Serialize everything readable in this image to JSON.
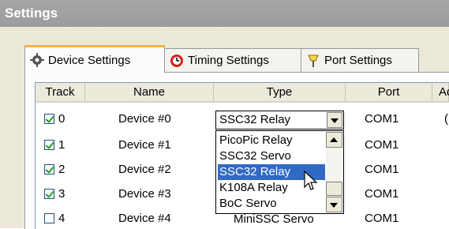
{
  "window": {
    "title": "Settings"
  },
  "tabs": [
    {
      "label": "Device Settings",
      "icon": "gear-icon",
      "active": true
    },
    {
      "label": "Timing Settings",
      "icon": "timer-icon",
      "active": false
    },
    {
      "label": "Port Settings",
      "icon": "port-icon",
      "active": false
    }
  ],
  "table": {
    "headers": [
      "Track",
      "Name",
      "Type",
      "Port",
      "Ad"
    ],
    "rows": [
      {
        "index": "0",
        "checked": true,
        "name": "Device #0",
        "type": "SSC32 Relay",
        "port": "COM1",
        "addr": "("
      },
      {
        "index": "1",
        "checked": true,
        "name": "Device #1",
        "type": "",
        "port": "COM1",
        "addr": ""
      },
      {
        "index": "2",
        "checked": true,
        "name": "Device #2",
        "type": "",
        "port": "COM1",
        "addr": ""
      },
      {
        "index": "3",
        "checked": true,
        "name": "Device #3",
        "type": "",
        "port": "COM1",
        "addr": ""
      },
      {
        "index": "4",
        "checked": false,
        "name": "Device #4",
        "type": "MiniSSC Servo",
        "port": "COM1",
        "addr": ""
      }
    ]
  },
  "combo": {
    "value": "SSC32 Relay",
    "options": [
      "PicoPic Relay",
      "SSC32 Servo",
      "SSC32 Relay",
      "K108A Relay",
      "BoC Servo"
    ],
    "selected_index": 2
  },
  "colors": {
    "selection": "#316ac5",
    "tab_accent": "#f7b34b",
    "title_bar": "#a0a0a0"
  }
}
